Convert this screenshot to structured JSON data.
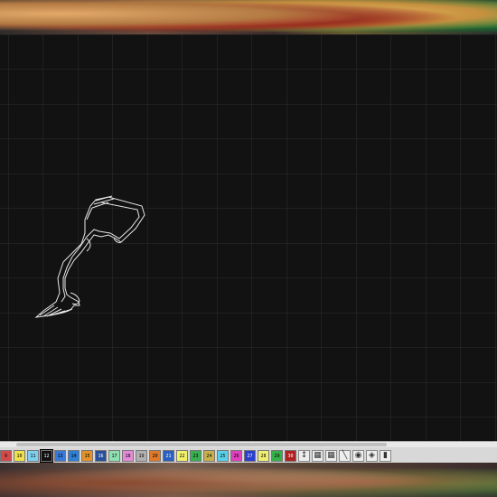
{
  "palette": {
    "swatches": [
      {
        "num": "9",
        "color": "#d44a4a"
      },
      {
        "num": "10",
        "color": "#f2e24a"
      },
      {
        "num": "11",
        "color": "#7fd0f0"
      },
      {
        "num": "12",
        "color": "#111111",
        "selected": true
      },
      {
        "num": "13",
        "color": "#3a78d8"
      },
      {
        "num": "14",
        "color": "#2f7fd6"
      },
      {
        "num": "15",
        "color": "#e3922a"
      },
      {
        "num": "16",
        "color": "#2a4f9a"
      },
      {
        "num": "17",
        "color": "#8fe0b0"
      },
      {
        "num": "18",
        "color": "#e58ad8"
      },
      {
        "num": "19",
        "color": "#b0b0b0"
      },
      {
        "num": "20",
        "color": "#e07a2a"
      },
      {
        "num": "21",
        "color": "#2a5fc0"
      },
      {
        "num": "22",
        "color": "#f0f06a"
      },
      {
        "num": "23",
        "color": "#36b050"
      },
      {
        "num": "24",
        "color": "#c8b04a"
      },
      {
        "num": "25",
        "color": "#5ad0e8"
      },
      {
        "num": "26",
        "color": "#e040c0"
      },
      {
        "num": "27",
        "color": "#2a3fd0"
      },
      {
        "num": "28",
        "color": "#f0f070"
      },
      {
        "num": "29",
        "color": "#36b04a"
      },
      {
        "num": "30",
        "color": "#b02020"
      }
    ],
    "tools": [
      {
        "icon": "dropdown-arrow-icon",
        "glyph": "↕"
      },
      {
        "icon": "stitch-pattern-icon",
        "glyph": "▦"
      },
      {
        "icon": "stitch-pattern-2-icon",
        "glyph": "▦"
      },
      {
        "icon": "line-icon",
        "glyph": "╲"
      },
      {
        "icon": "color-wheel-icon",
        "glyph": "◉"
      },
      {
        "icon": "color-palette-icon",
        "glyph": "◈"
      },
      {
        "icon": "thread-icon",
        "glyph": "▮"
      }
    ]
  }
}
